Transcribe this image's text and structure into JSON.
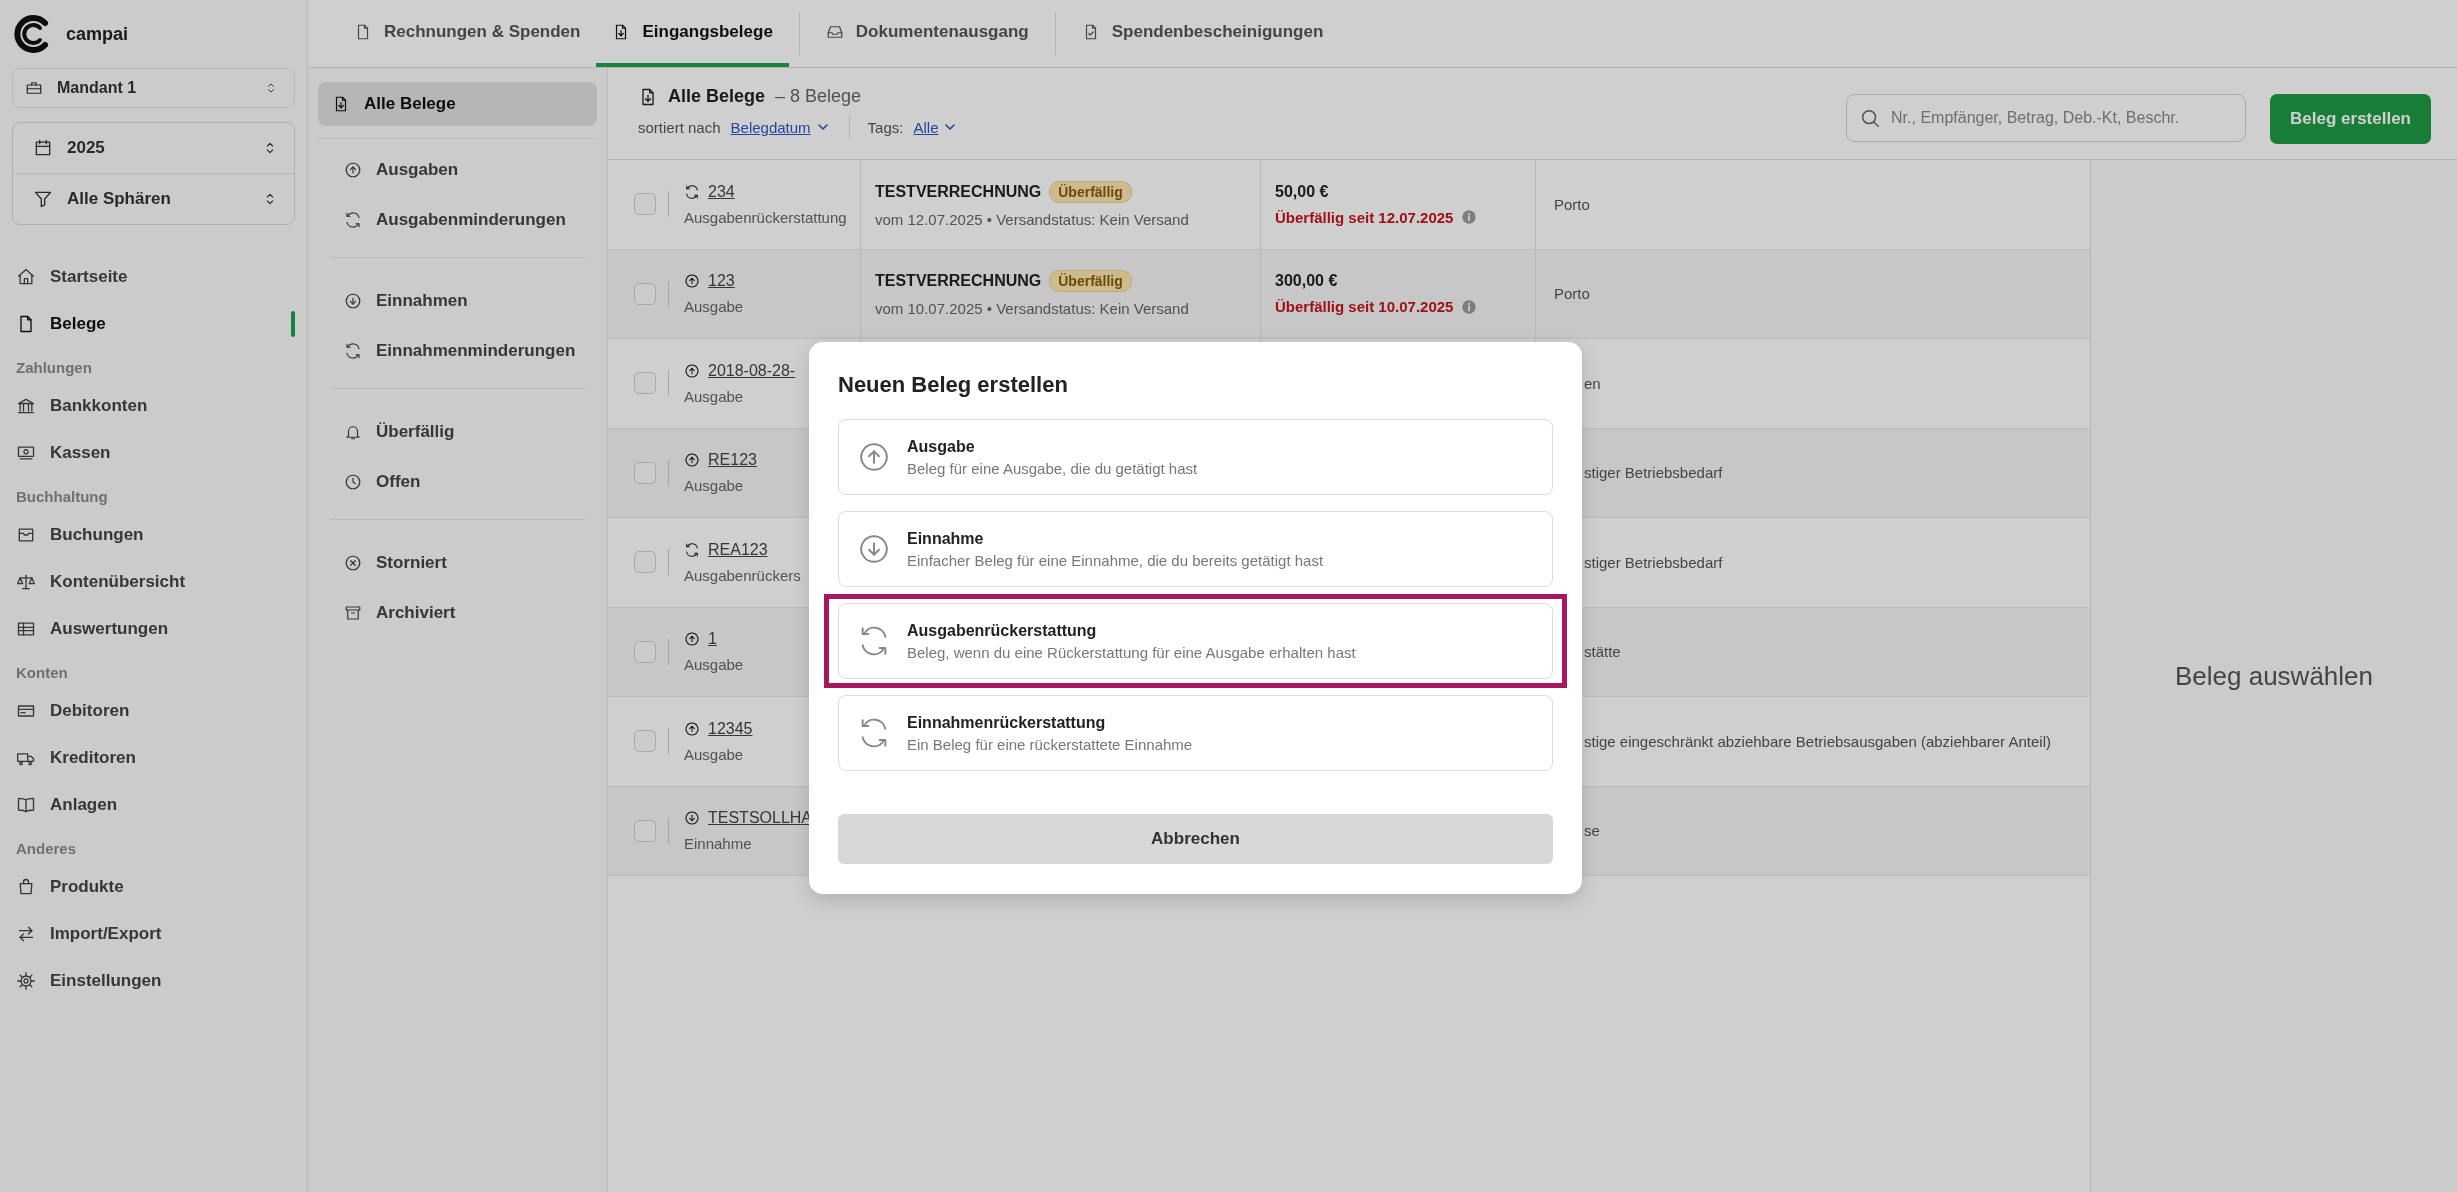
{
  "brand": {
    "name": "campai"
  },
  "sidebar": {
    "client": "Mandant 1",
    "year": "2025",
    "sphere": "Alle Sphären",
    "nav": [
      {
        "kind": "item",
        "label": "Startseite",
        "selected": false
      },
      {
        "kind": "item",
        "label": "Belege",
        "selected": true
      },
      {
        "kind": "heading",
        "label": "Zahlungen"
      },
      {
        "kind": "item",
        "label": "Bankkonten",
        "selected": false
      },
      {
        "kind": "item",
        "label": "Kassen",
        "selected": false
      },
      {
        "kind": "heading",
        "label": "Buchhaltung"
      },
      {
        "kind": "item",
        "label": "Buchungen",
        "selected": false
      },
      {
        "kind": "item",
        "label": "Kontenübersicht",
        "selected": false
      },
      {
        "kind": "item",
        "label": "Auswertungen",
        "selected": false
      },
      {
        "kind": "heading",
        "label": "Konten"
      },
      {
        "kind": "item",
        "label": "Debitoren",
        "selected": false
      },
      {
        "kind": "item",
        "label": "Kreditoren",
        "selected": false
      },
      {
        "kind": "item",
        "label": "Anlagen",
        "selected": false
      },
      {
        "kind": "heading",
        "label": "Anderes"
      },
      {
        "kind": "item",
        "label": "Produkte",
        "selected": false
      },
      {
        "kind": "item",
        "label": "Import/Export",
        "selected": false
      },
      {
        "kind": "item",
        "label": "Einstellungen",
        "selected": false
      }
    ]
  },
  "tabs": [
    {
      "label": "Rechnungen & Spenden",
      "selected": false
    },
    {
      "label": "Eingangsbelege",
      "selected": true
    },
    {
      "label": "Dokumentenausgang",
      "selected": false
    },
    {
      "label": "Spendenbescheinigungen",
      "selected": false
    }
  ],
  "subnav": [
    [
      {
        "label": "Alle Belege",
        "selected": true
      }
    ],
    [
      {
        "label": "Ausgaben",
        "selected": false
      },
      {
        "label": "Ausgabenminderungen",
        "selected": false
      }
    ],
    [
      {
        "label": "Einnahmen",
        "selected": false
      },
      {
        "label": "Einnahmenminderungen",
        "selected": false
      }
    ],
    [
      {
        "label": "Überfällig",
        "selected": false
      },
      {
        "label": "Offen",
        "selected": false
      }
    ],
    [
      {
        "label": "Storniert",
        "selected": false
      },
      {
        "label": "Archiviert",
        "selected": false
      }
    ]
  ],
  "list_header": {
    "title": "Alle Belege",
    "count": "– 8 Belege",
    "sort_label": "sortiert nach",
    "sort_value": "Belegdatum",
    "tags_label": "Tags:",
    "tags_value": "Alle"
  },
  "search": {
    "placeholder": "Nr., Empfänger, Betrag, Deb.-Kt, Beschr."
  },
  "create_button": "Beleg erstellen",
  "table": {
    "rows": [
      {
        "checked": false,
        "kind": "refund",
        "number": "234",
        "type": "Ausgabenrückerstattung",
        "title": "TESTVERRECHNUNG",
        "badge": "Überfällig",
        "meta": "vom 12.07.2025 • Versandstatus: Kein Versand",
        "amount": "50,00 €",
        "overdue": "Überfällig seit 12.07.2025",
        "description": "Porto"
      },
      {
        "checked": false,
        "kind": "expense",
        "number": "123",
        "type": "Ausgabe",
        "title": "TESTVERRECHNUNG",
        "badge": "Überfällig",
        "meta": "vom 10.07.2025 • Versandstatus: Kein Versand",
        "amount": "300,00 €",
        "overdue": "Überfällig seit 10.07.2025",
        "description": "Porto"
      },
      {
        "checked": false,
        "kind": "expense",
        "number": "2018-08-28-",
        "type": "Ausgabe",
        "description": "en"
      },
      {
        "checked": false,
        "kind": "expense",
        "number": "RE123",
        "type": "Ausgabe",
        "description": "stiger Betriebsbedarf"
      },
      {
        "checked": false,
        "kind": "refund",
        "number": "REA123",
        "type": "Ausgabenrückers",
        "description": "stiger Betriebsbedarf"
      },
      {
        "checked": false,
        "kind": "expense",
        "number": "1",
        "type": "Ausgabe",
        "description": "stätte"
      },
      {
        "checked": false,
        "kind": "expense",
        "number": "12345",
        "type": "Ausgabe",
        "description": "stige eingeschränkt abziehbare Betriebsausgaben (abziehbarer Anteil)"
      },
      {
        "checked": false,
        "kind": "income",
        "number": "TESTSOLLHA",
        "type": "Einnahme",
        "description": "se"
      }
    ]
  },
  "detail_panel": {
    "placeholder": "Beleg auswählen"
  },
  "modal": {
    "title": "Neuen Beleg erstellen",
    "options": [
      {
        "kind": "expense",
        "title": "Ausgabe",
        "description": "Beleg für eine Ausgabe, die du getätigt hast",
        "highlighted": false
      },
      {
        "kind": "income",
        "title": "Einnahme",
        "description": "Einfacher Beleg für eine Einnahme, die du bereits getätigt hast",
        "highlighted": false
      },
      {
        "kind": "refund",
        "title": "Ausgabenrückerstattung",
        "description": "Beleg, wenn du eine Rückerstattung für eine Ausgabe erhalten hast",
        "highlighted": true
      },
      {
        "kind": "refund",
        "title": "Einnahmenrückerstattung",
        "description": "Ein Beleg für eine rückerstattete Einnahme",
        "highlighted": false
      }
    ],
    "cancel": "Abbrechen"
  }
}
